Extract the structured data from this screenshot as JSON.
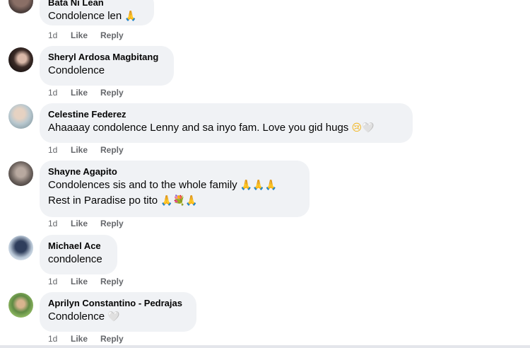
{
  "comments": [
    {
      "name": "Bata Ni Lean",
      "lines": [
        {
          "text": "Condolence len",
          "emoji": "🙏"
        }
      ],
      "time": "1d",
      "like": "Like",
      "reply": "Reply"
    },
    {
      "name": "Sheryl Ardosa Magbitang",
      "lines": [
        {
          "text": "Condolence",
          "emoji": ""
        }
      ],
      "time": "1d",
      "like": "Like",
      "reply": "Reply"
    },
    {
      "name": "Celestine Federez",
      "lines": [
        {
          "text": "Ahaaaay condolence Lenny and sa inyo fam. Love you gid hugs",
          "emoji": "😢🤍"
        }
      ],
      "time": "1d",
      "like": "Like",
      "reply": "Reply"
    },
    {
      "name": "Shayne Agapito",
      "lines": [
        {
          "text": "Condolences sis and to the whole family",
          "emoji": "🙏🙏🙏"
        },
        {
          "text": "Rest in Paradise po tito",
          "emoji": "🙏💐🙏"
        }
      ],
      "time": "1d",
      "like": "Like",
      "reply": "Reply"
    },
    {
      "name": "Michael Ace",
      "lines": [
        {
          "text": "condolence",
          "emoji": ""
        }
      ],
      "time": "1d",
      "like": "Like",
      "reply": "Reply"
    },
    {
      "name": "Aprilyn Constantino - Pedrajas",
      "lines": [
        {
          "text": "Condolence",
          "emoji": "🤍"
        }
      ],
      "time": "1d",
      "like": "Like",
      "reply": "Reply"
    }
  ]
}
